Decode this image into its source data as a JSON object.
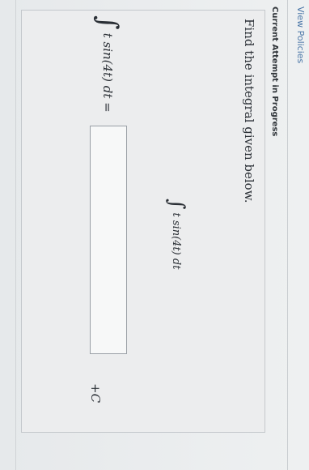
{
  "header": {
    "view_policies": "View Policies",
    "attempt_status": "Current Attempt in Progress"
  },
  "question": {
    "prompt": "Find the integral given below.",
    "integral_sign": "∫",
    "integrand": "t sin(4t) dt",
    "answer_lhs": "t sin(4t) dt =",
    "answer_value": "",
    "constant": "+C"
  }
}
